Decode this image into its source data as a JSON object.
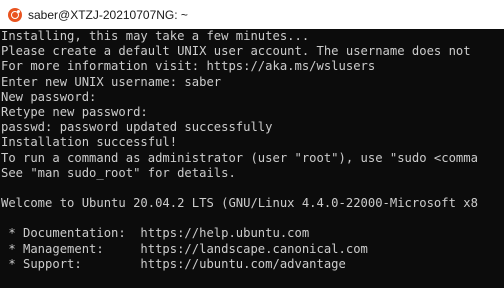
{
  "window": {
    "title": "saber@XTZJ-20210707NG: ~",
    "icon": "ubuntu-icon"
  },
  "terminal": {
    "lines": [
      "Installing, this may take a few minutes...",
      "Please create a default UNIX user account. The username does not",
      "For more information visit: https://aka.ms/wslusers",
      "Enter new UNIX username: saber",
      "New password:",
      "Retype new password:",
      "passwd: password updated successfully",
      "Installation successful!",
      "To run a command as administrator (user \"root\"), use \"sudo <comma",
      "See \"man sudo_root\" for details.",
      "",
      "Welcome to Ubuntu 20.04.2 LTS (GNU/Linux 4.4.0-22000-Microsoft x8",
      "",
      " * Documentation:  https://help.ubuntu.com",
      " * Management:     https://landscape.canonical.com",
      " * Support:        https://ubuntu.com/advantage"
    ],
    "colors": {
      "background": "#0c0c0c",
      "foreground": "#cccccc"
    }
  }
}
